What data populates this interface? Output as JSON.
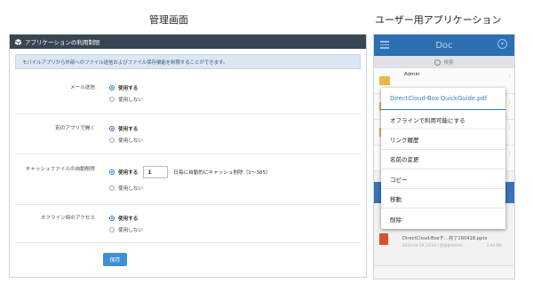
{
  "captions": {
    "admin": "管理画面",
    "user": "ユーザー用アプリケーション"
  },
  "admin": {
    "header_title": "アプリケーションの利用制限",
    "info_text": "モバイルアプリから外部へのファイル送信およびファイル保存機能を制限することができます。",
    "settings": [
      {
        "label": "メール送信",
        "options": [
          "使用する",
          "使用しない"
        ],
        "selected": 0
      },
      {
        "label": "別のアプリで開く",
        "options": [
          "使用する",
          "使用しない"
        ],
        "selected": 0
      },
      {
        "label": "キャッシュファイルの自動削除",
        "options": [
          "使用する",
          "使用しない"
        ],
        "selected": 0,
        "input_value": "1",
        "input_suffix": "日毎に自動的にキャッシュ削除（1〜365）"
      },
      {
        "label": "オフライン時のアクセス",
        "options": [
          "使用する",
          "使用しない"
        ],
        "selected": 0
      }
    ],
    "save_label": "保存"
  },
  "app": {
    "title": "Doc",
    "search_placeholder": "検索",
    "rows": [
      {
        "name": "Admin"
      }
    ],
    "pptx_name": "DirectCloud-Boxチ…完了160418.pptx",
    "pptx_meta": "2016-04-19 13:18 / 管理者Admin",
    "pptx_size": "2.93 MB",
    "menu": {
      "title": "DirectCloud-Box QuickGuide.pdf",
      "items": [
        "オフラインで利用可能にする",
        "リンク履歴",
        "名前の変更",
        "コピー",
        "移動",
        "削除"
      ]
    }
  }
}
